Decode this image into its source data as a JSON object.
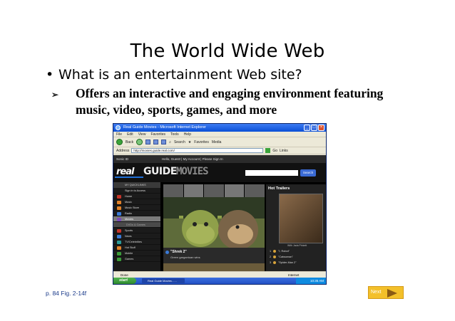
{
  "slide": {
    "title": "The World Wide Web",
    "bullet_1": "What is an entertainment Web site?",
    "bullet_2": "Offers an interactive and engaging environment featuring music, video, sports, games, and more",
    "reference": "p. 84 Fig. 2-14f",
    "next_label": "Next"
  },
  "browser": {
    "title": "Real Guide Movies - Microsoft Internet Explorer",
    "menu": [
      "File",
      "Edit",
      "View",
      "Favorites",
      "Tools",
      "Help"
    ],
    "toolbar": {
      "back": "Back",
      "search": "Search",
      "favorites": "Favorites",
      "media": "Media"
    },
    "address_label": "Address",
    "address_value": "http://movies.guide.real.com/",
    "go_label": "Go",
    "links_label": "Links",
    "status": "Done",
    "zone": "Internet",
    "start_label": "start",
    "task_label": "Real Guide Movies - ...",
    "clock": "10:35 AM"
  },
  "site": {
    "topbar_left": "Sonic ID",
    "topbar_right": "Hello, Guest! | My Account | Please Sign In",
    "logo_real": "real",
    "logo_guide": "GUIDE",
    "logo_movies": "MOVIES",
    "search_button": "Search",
    "sidebar_head": "MY QUICKLINKS",
    "sidebar": [
      {
        "label": "Sign in to Access",
        "color": "",
        "type": ""
      },
      {
        "label": "Home",
        "color": "red",
        "type": ""
      },
      {
        "label": "Music",
        "color": "orange",
        "type": ""
      },
      {
        "label": "Music Store",
        "color": "orange",
        "type": ""
      },
      {
        "label": "Radio",
        "color": "blue",
        "type": ""
      },
      {
        "label": "Movies",
        "color": "purple",
        "type": "active"
      },
      {
        "label": "DVDs & Games",
        "color": "",
        "type": "sub"
      },
      {
        "label": "Sports",
        "color": "red",
        "type": ""
      },
      {
        "label": "News",
        "color": "blue",
        "type": ""
      },
      {
        "label": "TV/Celebrities",
        "color": "teal",
        "type": ""
      },
      {
        "label": "Hot Stuff",
        "color": "orange",
        "type": ""
      },
      {
        "label": "Mobile",
        "color": "green",
        "type": ""
      },
      {
        "label": "Games",
        "color": "green",
        "type": ""
      }
    ],
    "feature_title": "\"Shrek 2\"",
    "feature_sub": "Green gargantuan wins",
    "hot_title": "Hot Trailers",
    "hot_caption": "With Jada Pinkett",
    "hot_list": [
      {
        "num": "1",
        "label": "\"I, Robot\""
      },
      {
        "num": "2",
        "label": "\"Catwoman\""
      },
      {
        "num": "3",
        "label": "\"Spider-Man 2\""
      }
    ]
  },
  "colors": {
    "next_button": "#f3c02a",
    "reference_text": "#1a3a8a",
    "site_search": "#3a6ad4"
  }
}
